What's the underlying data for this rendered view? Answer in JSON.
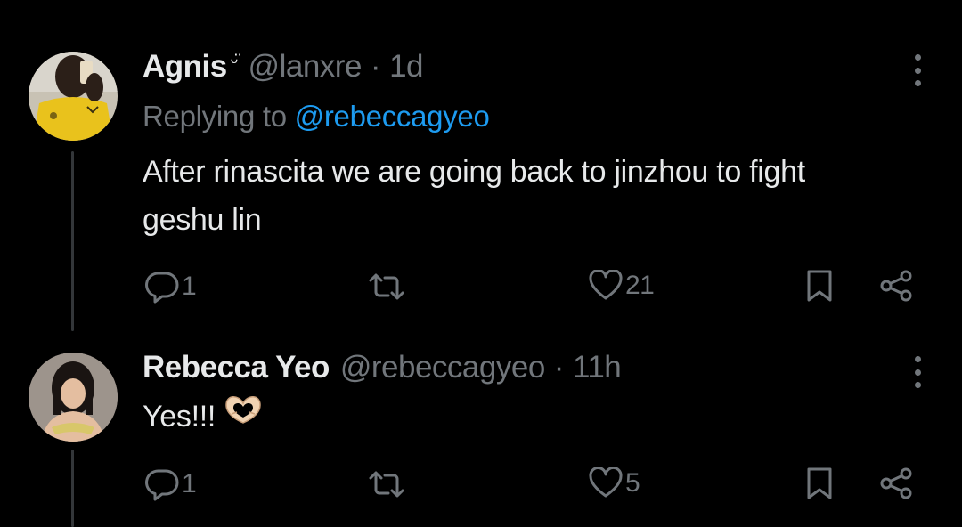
{
  "colors": {
    "background": "#000000",
    "primary_text": "#e7e9ea",
    "secondary_text": "#71767b",
    "link": "#1d9bf0",
    "thread_line": "#333639"
  },
  "posts": [
    {
      "display_name": "Agnis",
      "badge": "ᵕ̈",
      "handle": "@lanxre",
      "separator": "·",
      "time": "1d",
      "replying_prefix": "Replying to ",
      "replying_to": "@rebeccagyeo",
      "text_lines": [
        "After rinascita we are going back to jinzhou to fight",
        "geshu lin"
      ],
      "actions": {
        "reply_icon": "reply-icon",
        "reply_count": "1",
        "repost_icon": "repost-icon",
        "repost_count": "",
        "like_icon": "heart-icon",
        "like_count": "21",
        "bookmark_icon": "bookmark-icon",
        "share_icon": "share-icon"
      }
    },
    {
      "display_name": "Rebecca Yeo",
      "handle": "@rebeccagyeo",
      "separator": "·",
      "time": "11h",
      "text": "Yes!!!",
      "emoji": "heart-hands-emoji",
      "actions": {
        "reply_icon": "reply-icon",
        "reply_count": "1",
        "repost_icon": "repost-icon",
        "repost_count": "",
        "like_icon": "heart-icon",
        "like_count": "5",
        "bookmark_icon": "bookmark-icon",
        "share_icon": "share-icon"
      }
    }
  ]
}
